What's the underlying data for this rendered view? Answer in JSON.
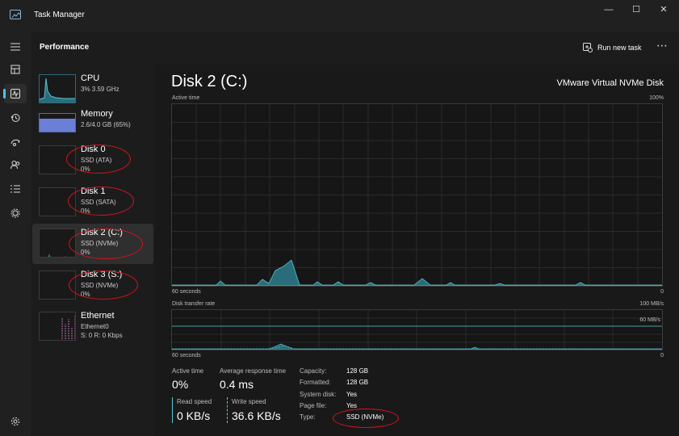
{
  "window": {
    "title": "Task Manager"
  },
  "header": {
    "heading": "Performance",
    "run_new_task": "Run new task"
  },
  "colors": {
    "accent": "#4cc2ff",
    "disk_graph": "#58c4d6",
    "memory_fill": "#6c7fd6",
    "annotation": "#d4151b"
  },
  "icons": [
    "hamburger-icon",
    "processes-icon",
    "performance-icon",
    "app-history-icon",
    "startup-apps-icon",
    "users-icon",
    "details-icon",
    "services-icon",
    "settings-icon"
  ],
  "sidebar": {
    "items": [
      {
        "name": "CPU",
        "sub": "3%  3.59 GHz",
        "val": ""
      },
      {
        "name": "Memory",
        "sub": "2.6/4.0 GB (65%)",
        "val": ""
      },
      {
        "name": "Disk 0",
        "sub": "SSD (ATA)",
        "val": "0%"
      },
      {
        "name": "Disk 1",
        "sub": "SSD (SATA)",
        "val": "0%"
      },
      {
        "name": "Disk 2 (C:)",
        "sub": "SSD (NVMe)",
        "val": "0%"
      },
      {
        "name": "Disk 3 (S:)",
        "sub": "SSD (NVMe)",
        "val": "0%"
      },
      {
        "name": "Ethernet",
        "sub": "Ethernet0",
        "val": "S: 0 R: 0 Kbps"
      }
    ]
  },
  "main": {
    "title": "Disk 2 (C:)",
    "model": "VMware Virtual NVMe Disk",
    "active_graph": {
      "label": "Active time",
      "max": "100%",
      "time_left": "60 seconds",
      "time_right": "0"
    },
    "transfer_graph": {
      "label": "Disk transfer rate",
      "max": "100 MB/s",
      "mid": "60 MB/s",
      "time_left": "60 seconds",
      "time_right": "0"
    },
    "stats": {
      "active_time_label": "Active time",
      "active_time_value": "0%",
      "response_label": "Average response time",
      "response_value": "0.4 ms",
      "read_label": "Read speed",
      "read_value": "0 KB/s",
      "write_label": "Write speed",
      "write_value": "36.6 KB/s"
    },
    "properties": [
      {
        "label": "Capacity:",
        "value": "128 GB"
      },
      {
        "label": "Formatted:",
        "value": "128 GB"
      },
      {
        "label": "System disk:",
        "value": "Yes"
      },
      {
        "label": "Page file:",
        "value": "Yes"
      },
      {
        "label": "Type:",
        "value": "SSD (NVMe)"
      }
    ]
  }
}
